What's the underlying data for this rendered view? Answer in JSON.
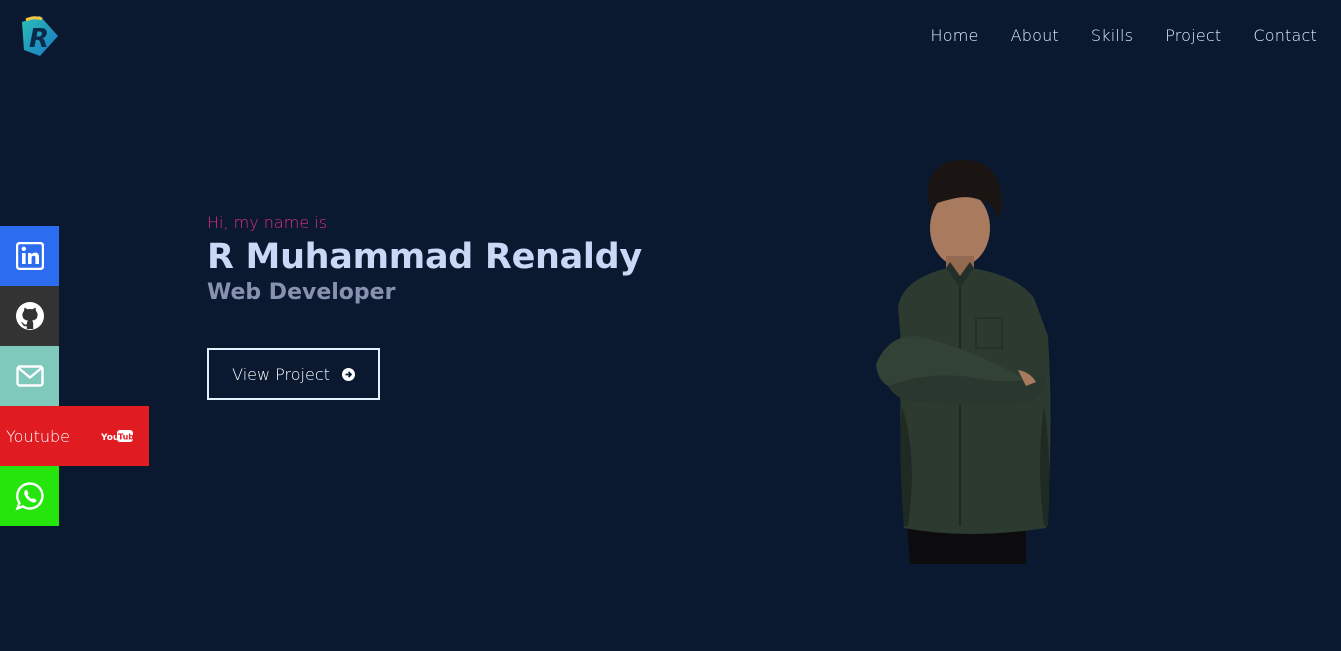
{
  "header": {
    "logo_letter": "R",
    "nav": [
      {
        "label": "Home"
      },
      {
        "label": "About"
      },
      {
        "label": "Skills"
      },
      {
        "label": "Project"
      },
      {
        "label": "Contact"
      }
    ]
  },
  "social": {
    "items": [
      {
        "icon": "linkedin-icon",
        "color": "#2c6cf0"
      },
      {
        "icon": "github-icon",
        "color": "#333333"
      },
      {
        "icon": "mail-icon",
        "color": "#7ec8bc"
      },
      {
        "icon": "youtube-icon",
        "label": "Youtube",
        "color": "#e01b22"
      },
      {
        "icon": "whatsapp-icon",
        "color": "#25e50d"
      }
    ]
  },
  "hero": {
    "greeting": "Hi, my name is",
    "name": "R Muhammad Renaldy",
    "role": "Web Developer",
    "button_label": "View Project"
  },
  "colors": {
    "background": "#0a192f",
    "accent": "#e0307f",
    "name": "#ccd6f6",
    "role": "#8892b0"
  }
}
